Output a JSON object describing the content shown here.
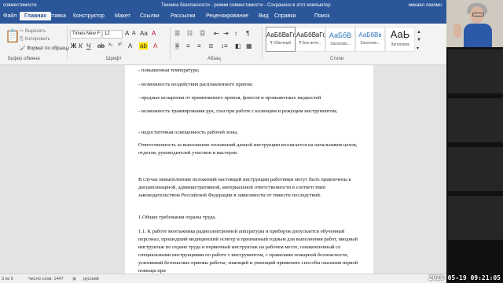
{
  "titlebar": {
    "left": "совместимости",
    "center": "Техника безопасности - режим совместимости - Сохранено в этот компьютер",
    "right": "микаел лекомн"
  },
  "tabs": [
    "Файл",
    "Главная",
    "Вставка",
    "Конструктор",
    "Макет",
    "Ссылки",
    "Рассылки",
    "Рецензирование",
    "Вид",
    "Справка",
    "Поиск"
  ],
  "clipboard": {
    "cut": "Вырезать",
    "copy": "Копировать",
    "format": "Формат по образцу",
    "label": "Буфер обмена"
  },
  "font": {
    "name": "Times New F",
    "size": "12",
    "label": "Шрифт"
  },
  "paragraph": {
    "label": "Абзац"
  },
  "styles": {
    "label": "Стили",
    "items": [
      {
        "preview": "АаБбВвГг,",
        "name": "¶ Обычный"
      },
      {
        "preview": "АаБбВвГг,",
        "name": "¶ Без инте..."
      },
      {
        "preview": "АаБбВ",
        "name": "Заголово..."
      },
      {
        "preview": "АаБбВв",
        "name": "Заголово..."
      },
      {
        "preview": "АаЬ",
        "name": "Заголовок"
      }
    ]
  },
  "document": {
    "paragraphs": [
      "- повышенная температура;",
      "- возможность воздействия расплавленного припоя;",
      "- вредные испарения от применяемого припоя, флюсов и промывочных жидкостей",
      "- возможность травмирования рук, глаз при работе с колющим и режущим инструментом;",
      "- недостаточная  освещенность рабочей зоны.",
      "Ответственность за выполнение положений данной инструкции возлагается на начальников цехов, отделов, руководителей участков и мастеров.",
      "В случае невыполнения положений настоящей инструкции работники могут быть привлечены к дисциплинарной, административной, материальной ответственности в соответствии законодательством Российской Федерации в зависимости от тяжести последствий.",
      "1.Общие требования охраны труда.",
      "1.1. К работе монтажника радиоэлектронной аппаратуры и приборов допускается обученный персонал, прошедший медицинский осмотр и признанный годным для выполнения работ, вводный инструктаж по охране труда и  первичный инструктаж на рабочем месте, ознакомленный со специальными инструкциями по работе с инструментом, с правилами пожарной безопасности, усвоивший безопасные приемы работы, знающий и умеющий применять способы оказания первой помощи при"
    ]
  },
  "statusbar": {
    "page": "3 из 5",
    "words": "Число слов: 1447",
    "lang": "русский"
  },
  "timestamp": "2020-05-19  09:21:05"
}
